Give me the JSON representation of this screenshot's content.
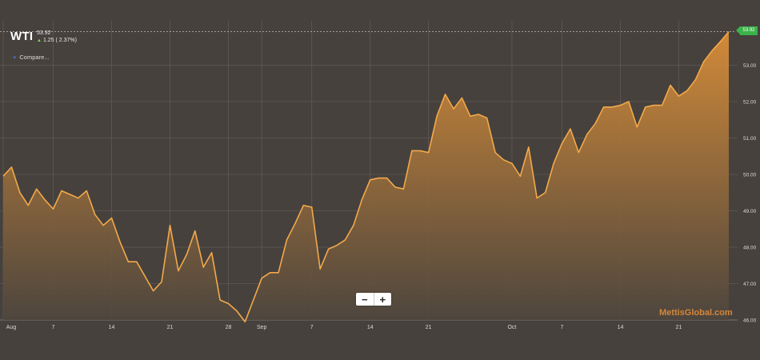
{
  "header": {
    "symbol": "WTI",
    "last_price": "53.92",
    "change_arrow": "▲",
    "change": "1.25 ( 2.37%)"
  },
  "compare": {
    "icon": "plus-icon",
    "label": "Compare..."
  },
  "zoom": {
    "minus_label": "−",
    "plus_label": "+"
  },
  "watermark": "MettisGlobal.com",
  "price_badge": "53.92",
  "colors": {
    "background": "#46413d",
    "grid": "#5f5a55",
    "line": "#f3a94a",
    "fill_top": "#d98e38",
    "fill_bottom": "#4e463e",
    "axis_text": "#d8d8d8",
    "badge": "#3bb34a",
    "watermark": "#d3873a"
  },
  "chart_data": {
    "type": "area",
    "title": "WTI",
    "xlabel": "",
    "ylabel": "",
    "ylim": [
      46.0,
      54.0
    ],
    "yticks": [
      "46.00",
      "47.00",
      "48.00",
      "49.00",
      "50.00",
      "51.00",
      "52.00",
      "53.00"
    ],
    "ytick_values": [
      46,
      47,
      48,
      49,
      50,
      51,
      52,
      53
    ],
    "xticks": [
      {
        "label": "Aug",
        "day": 1
      },
      {
        "label": "7",
        "day": 7
      },
      {
        "label": "14",
        "day": 14
      },
      {
        "label": "21",
        "day": 21
      },
      {
        "label": "28",
        "day": 28
      },
      {
        "label": "Sep",
        "day": 32
      },
      {
        "label": "7",
        "day": 38
      },
      {
        "label": "14",
        "day": 45
      },
      {
        "label": "21",
        "day": 52
      },
      {
        "label": "Oct",
        "day": 62
      },
      {
        "label": "7",
        "day": 68
      },
      {
        "label": "14",
        "day": 75
      },
      {
        "label": "21",
        "day": 82
      }
    ],
    "xlim_days": [
      1,
      88
    ],
    "x_days": [
      1,
      2,
      3,
      4,
      5,
      6,
      7,
      8,
      9,
      10,
      11,
      12,
      13,
      14,
      15,
      16,
      17,
      18,
      19,
      20,
      21,
      22,
      23,
      24,
      25,
      26,
      27,
      28,
      29,
      30,
      31,
      32,
      33,
      34,
      35,
      36,
      37,
      38,
      39,
      40,
      41,
      42,
      43,
      44,
      45,
      46,
      47,
      48,
      49,
      50,
      51,
      52,
      53,
      54,
      55,
      56,
      57,
      58,
      59,
      60,
      61,
      62,
      63,
      64,
      65,
      66,
      67,
      68,
      69,
      70,
      71,
      72,
      73,
      74,
      75,
      76,
      77,
      78,
      79,
      80,
      81,
      82,
      83,
      84,
      85,
      86,
      87,
      88
    ],
    "series": [
      {
        "name": "WTI",
        "values": [
          49.95,
          50.2,
          49.5,
          49.15,
          49.6,
          49.3,
          49.05,
          49.55,
          49.45,
          49.35,
          49.55,
          48.9,
          48.6,
          48.8,
          48.15,
          47.6,
          47.6,
          47.2,
          46.8,
          47.05,
          48.6,
          47.35,
          47.8,
          48.45,
          47.45,
          47.85,
          46.55,
          46.45,
          46.25,
          45.95,
          46.55,
          47.15,
          47.3,
          47.3,
          48.2,
          48.65,
          49.15,
          49.1,
          47.4,
          47.95,
          48.05,
          48.2,
          48.6,
          49.3,
          49.85,
          49.9,
          49.9,
          49.65,
          49.6,
          50.65,
          50.65,
          50.6,
          51.6,
          52.2,
          51.8,
          52.1,
          51.6,
          51.65,
          51.55,
          50.6,
          50.4,
          50.3,
          49.95,
          50.75,
          49.35,
          49.5,
          50.3,
          50.85,
          51.25,
          50.6,
          51.1,
          51.4,
          51.85,
          51.85,
          51.9,
          52.0,
          51.3,
          51.85,
          51.9,
          51.9,
          52.45,
          52.15,
          52.3,
          52.6,
          53.1,
          53.4,
          53.65,
          53.92
        ]
      }
    ]
  }
}
